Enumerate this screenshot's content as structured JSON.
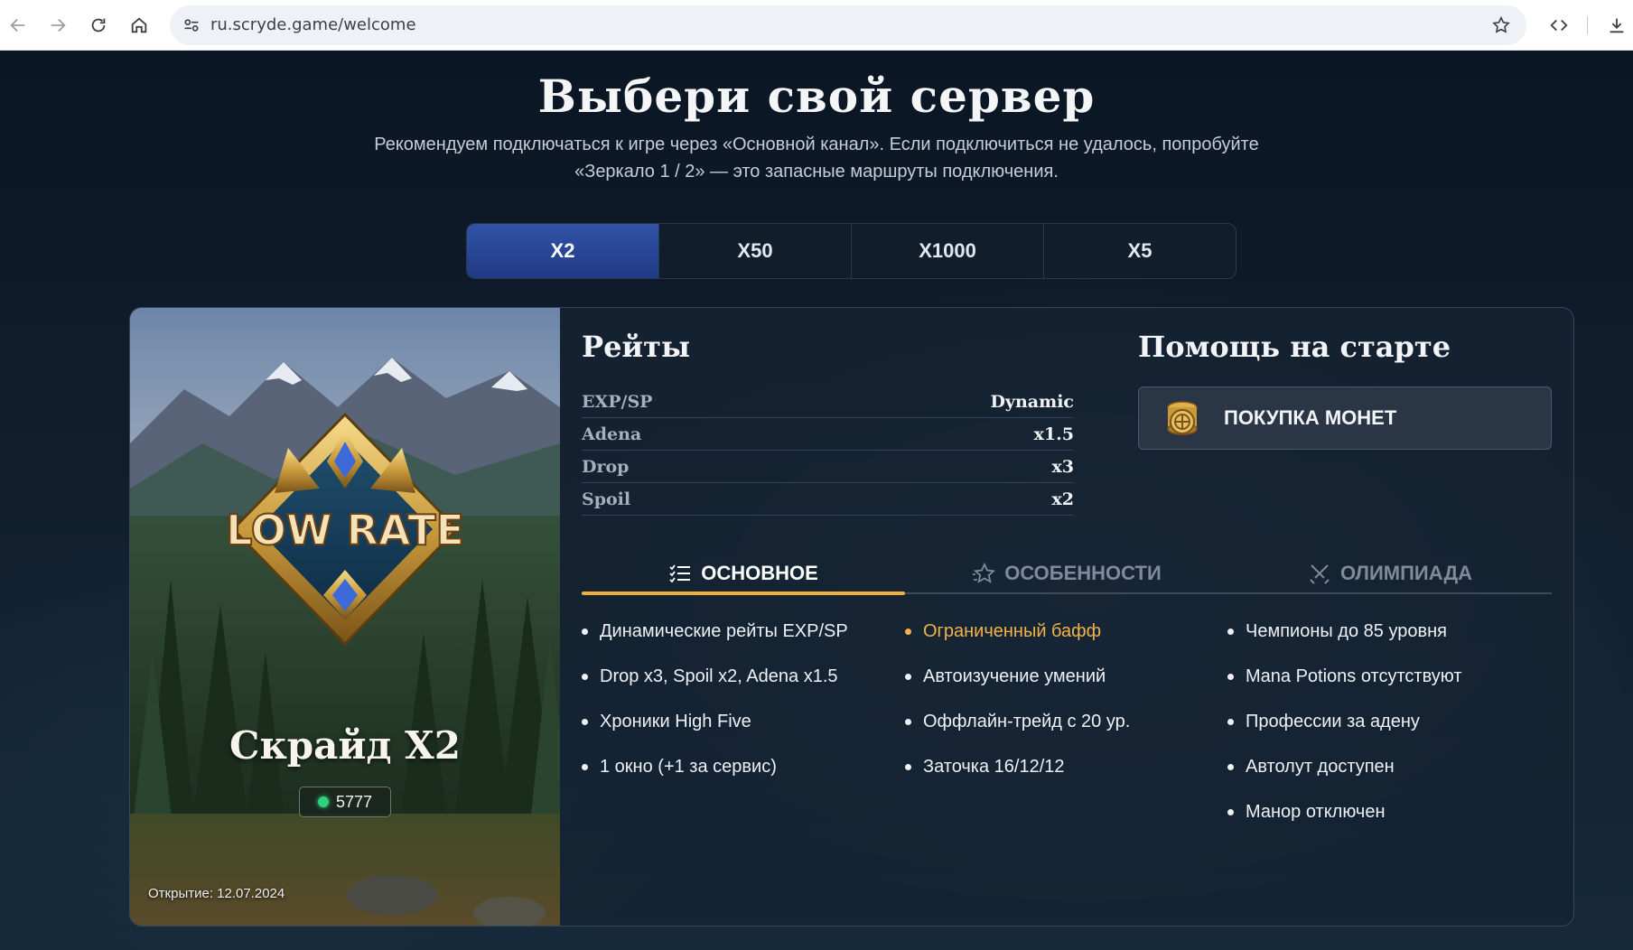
{
  "browser": {
    "url": "ru.scryde.game/welcome"
  },
  "hero": {
    "title": "Выбери свой сервер",
    "subtitle_line1": "Рекомендуем подключаться к игре через «Основной канал». Если подключиться не удалось, попробуйте",
    "subtitle_line2": "«Зеркало 1 / 2» — это запасные маршруты подключения."
  },
  "server_tabs": [
    {
      "label": "X2",
      "active": true
    },
    {
      "label": "X50",
      "active": false
    },
    {
      "label": "X1000",
      "active": false
    },
    {
      "label": "X5",
      "active": false
    }
  ],
  "server_card": {
    "badge_text": "LOW RATE",
    "name": "Скрайд X2",
    "online_count": "5777",
    "opening": "Открытие: 12.07.2024"
  },
  "rates": {
    "title": "Рейты",
    "rows": [
      {
        "key": "EXP/SP",
        "value": "Dynamic"
      },
      {
        "key": "Adena",
        "value": "x1.5"
      },
      {
        "key": "Drop",
        "value": "x3"
      },
      {
        "key": "Spoil",
        "value": "x2"
      }
    ]
  },
  "help": {
    "title": "Помощь на старте",
    "coin_button": "ПОКУПКА МОНЕТ",
    "coin_icon": "coin-stack-icon"
  },
  "info_tabs": [
    {
      "label": "ОСНОВНОЕ",
      "icon": "list-icon",
      "active": true
    },
    {
      "label": "ОСОБЕННОСТИ",
      "icon": "star-icon",
      "active": false
    },
    {
      "label": "ОЛИМПИАДА",
      "icon": "swords-icon",
      "active": false
    }
  ],
  "features": {
    "col1": [
      "Динамические рейты EXP/SP",
      "Drop x3, Spoil x2, Adena x1.5",
      "Хроники High Five",
      "1 окно (+1 за сервис)"
    ],
    "col2": [
      "Ограниченный бафф",
      "Автоизучение умений",
      "Оффлайн-трейд с 20 ур.",
      "Заточка 16/12/12"
    ],
    "col3": [
      "Чемпионы до 85 уровня",
      "Mana Potions отсутствуют",
      "Профессии за адену",
      "Автолут доступен",
      "Манор отключен"
    ]
  },
  "colors": {
    "accent_gold": "#f0b03a",
    "tab_active_blue": "#2a4a9a",
    "online_green": "#2fd27a"
  }
}
